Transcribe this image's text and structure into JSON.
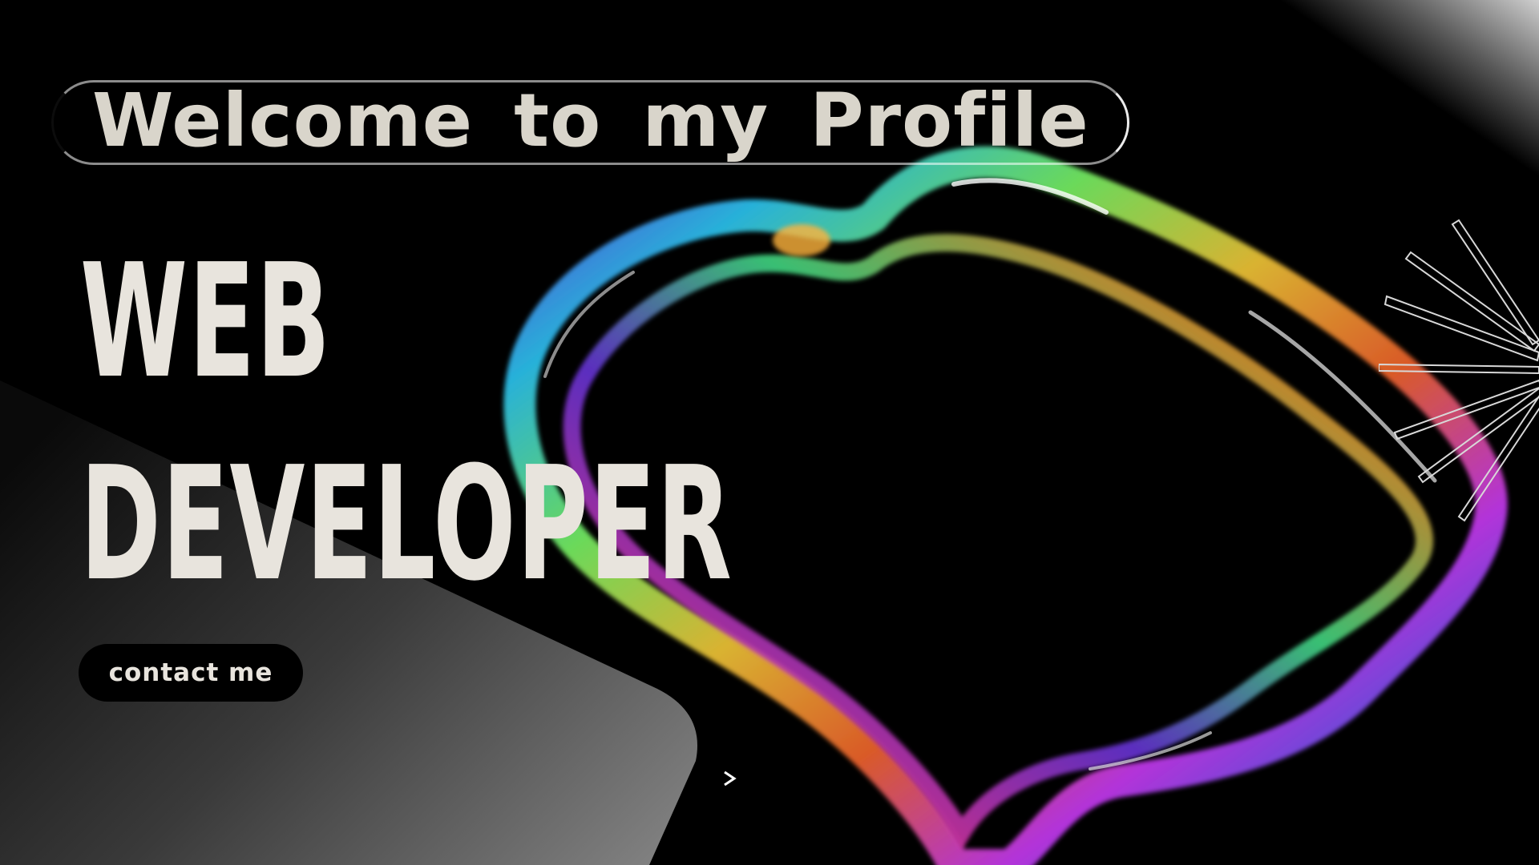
{
  "page": {
    "welcome_text": "Welcome to my Profile",
    "title_line_1": "WEB",
    "title_line_2": "DEVELOPER",
    "contact_label": "contact me"
  },
  "colors": {
    "background": "#000000",
    "text_light": "#e8e4dd",
    "welcome_text": "#d9d5cb",
    "panel_gray_light": "#7a7a7a",
    "panel_gray_dark": "#151515"
  },
  "icons": {
    "arrow": "arrow-right-icon",
    "sunburst": "sunburst-lines-icon",
    "bubble": "iridescent-bubble-ring"
  }
}
